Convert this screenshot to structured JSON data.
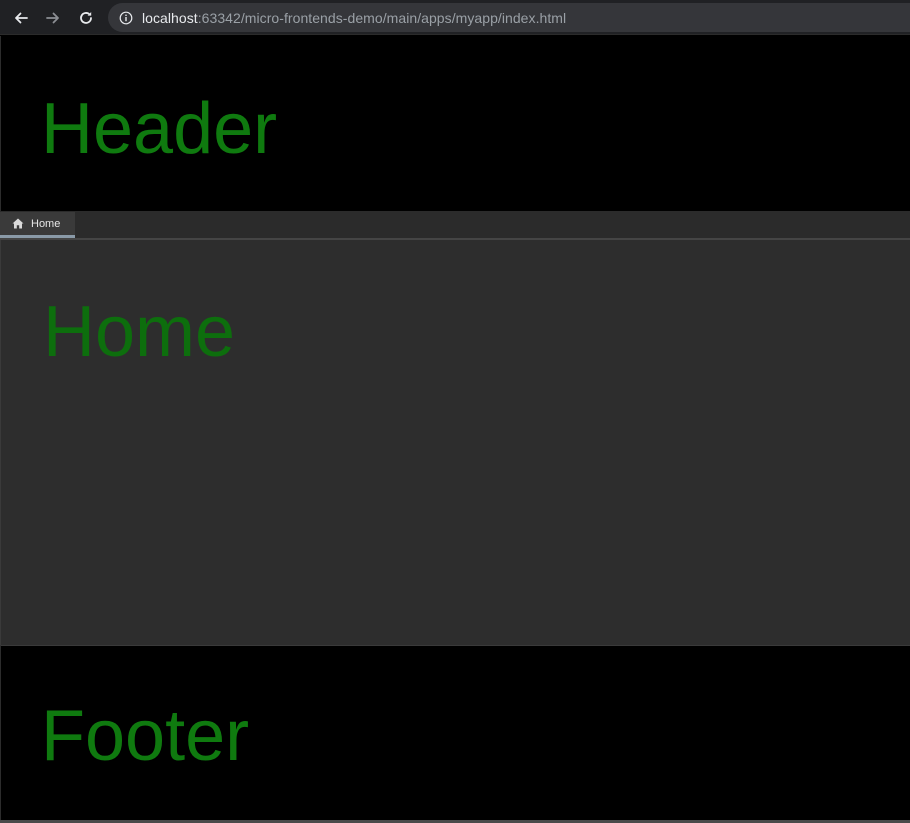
{
  "browser": {
    "url_host": "localhost",
    "url_rest": ":63342/micro-frontends-demo/main/apps/myapp/index.html",
    "icons": {
      "back": "arrow-left",
      "forward": "arrow-right",
      "reload": "reload",
      "site_info": "info-circle"
    }
  },
  "app": {
    "header": {
      "title": "Header"
    },
    "tabs": [
      {
        "label": "Home",
        "icon": "home-icon",
        "active": true
      }
    ],
    "content": {
      "title": "Home"
    },
    "footer": {
      "title": "Footer"
    },
    "colors": {
      "accent_green": "#0f7a0f",
      "header_bg": "#000000",
      "content_bg": "#2d2d2d",
      "tabbar_bg": "#2b2b2b",
      "tab_active_indicator": "#8a9aa8"
    }
  }
}
